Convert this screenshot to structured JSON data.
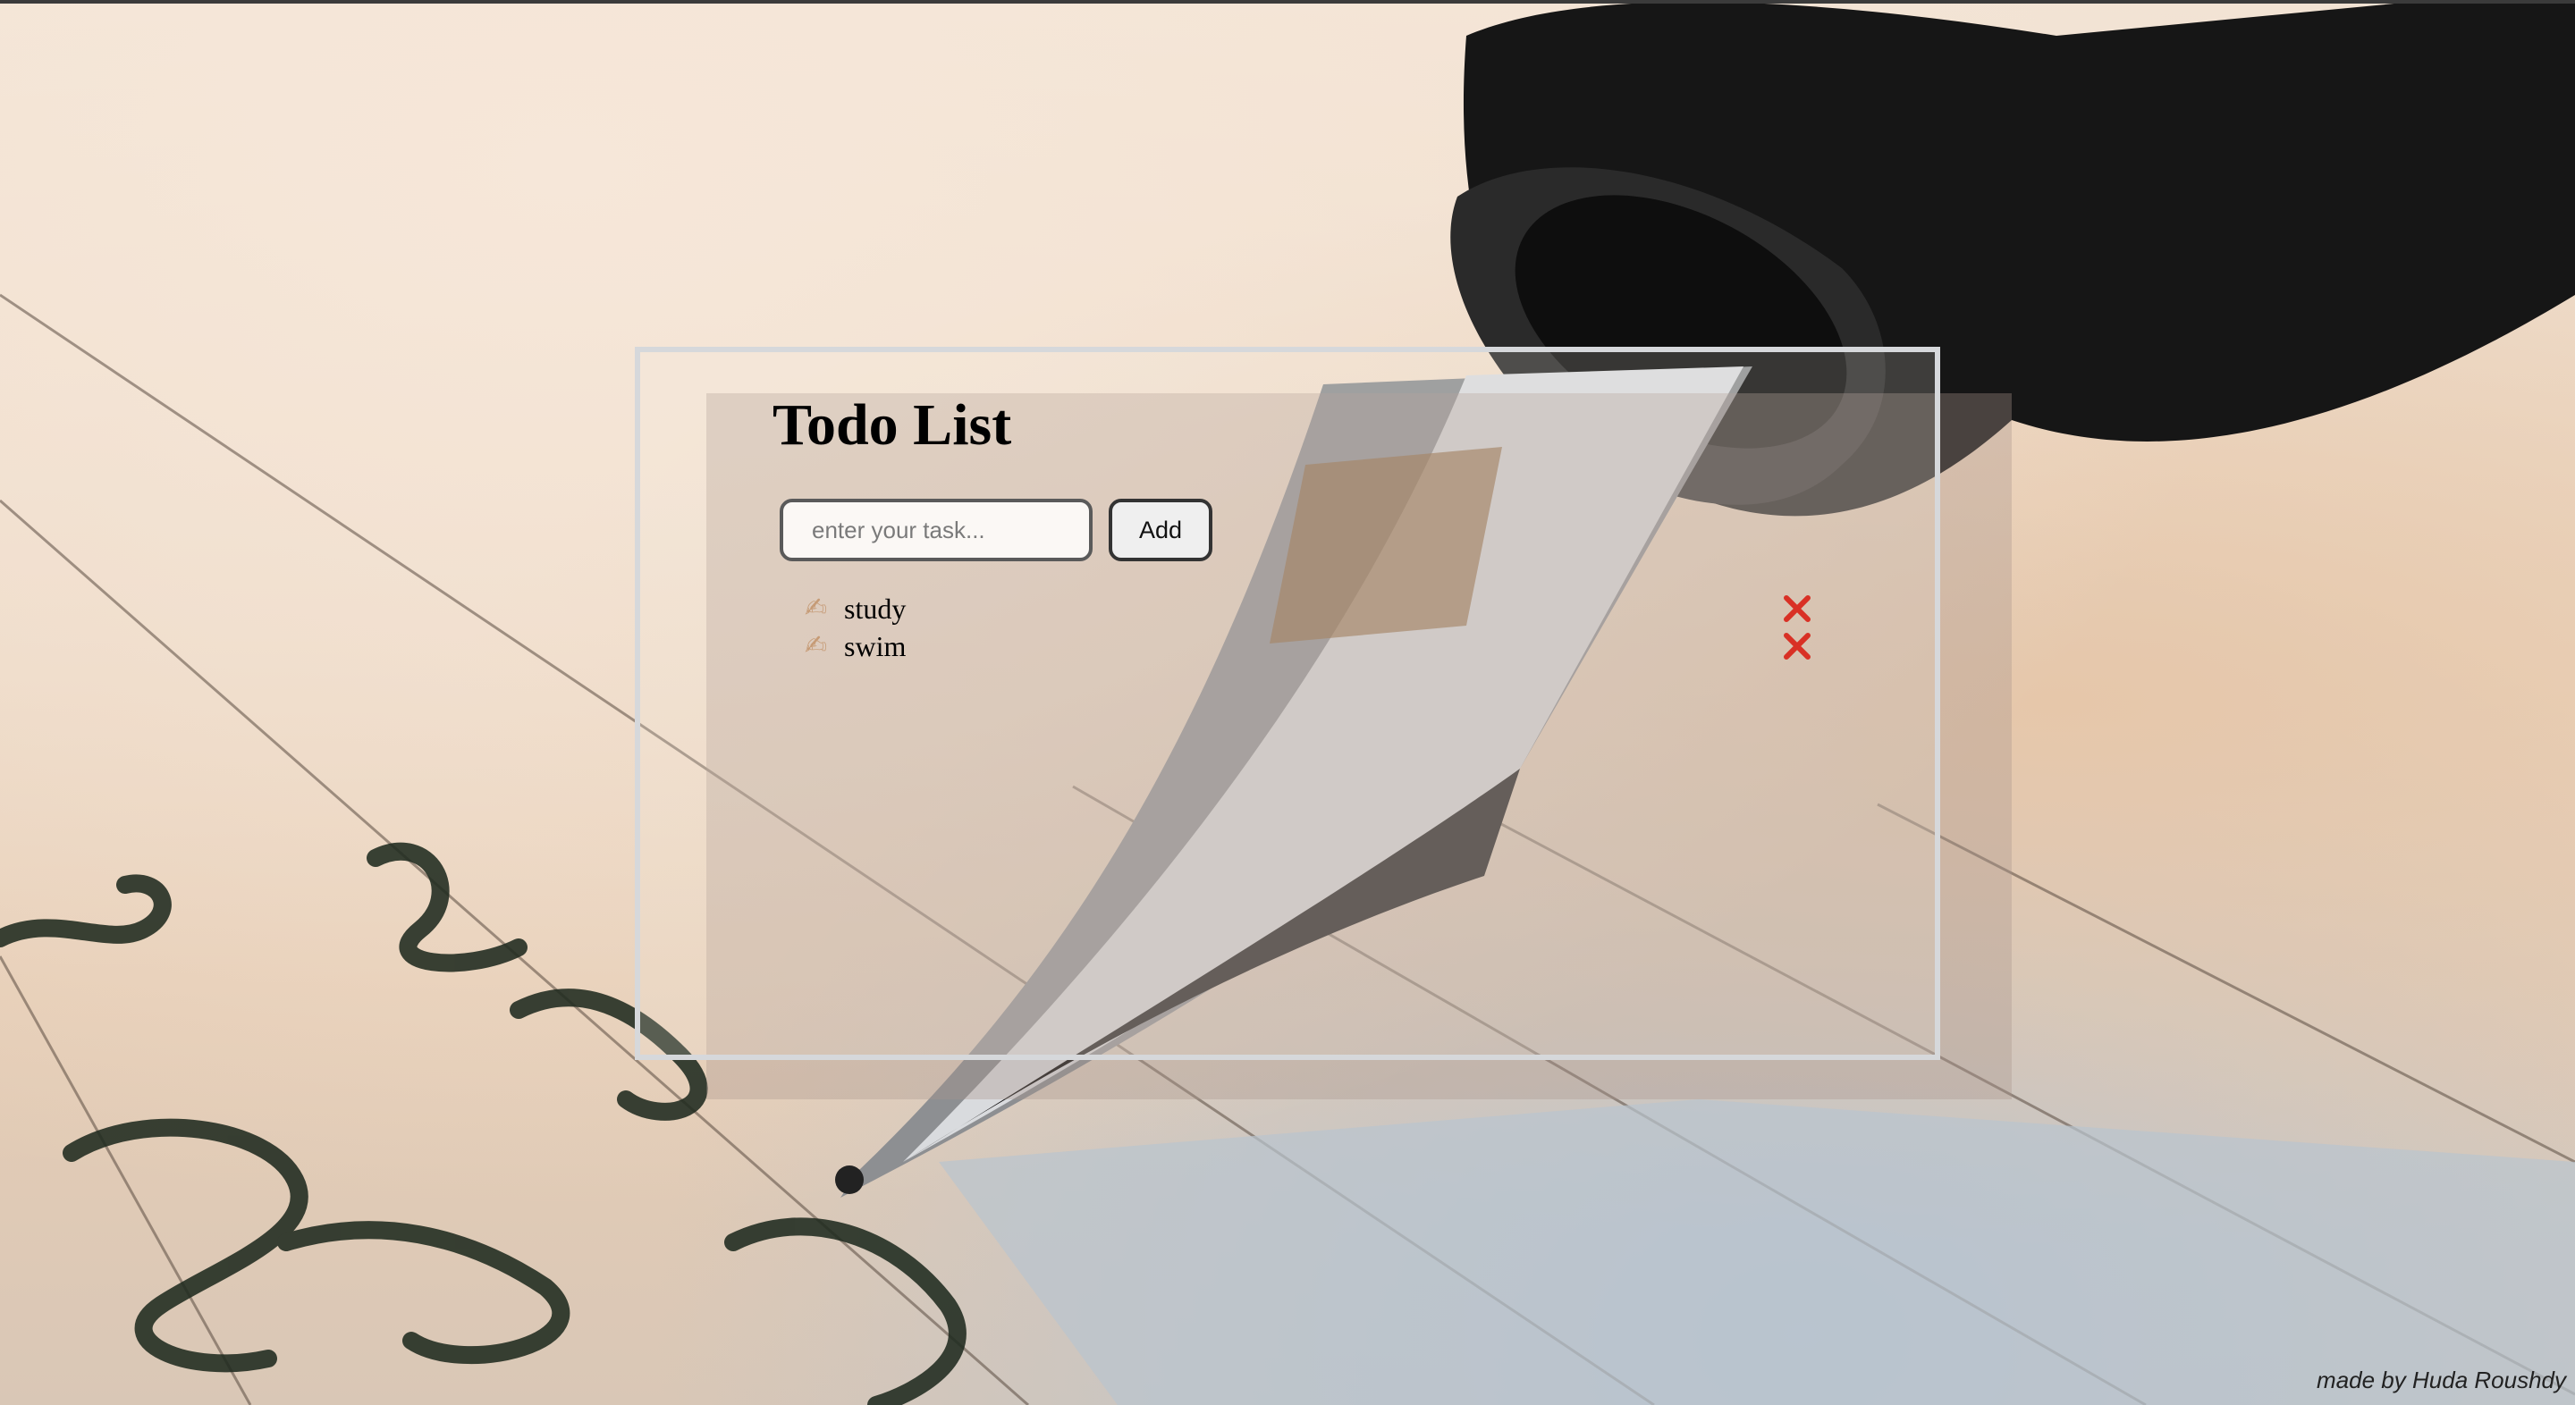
{
  "background": {
    "icon": "fountain-pen-writing-photo"
  },
  "app": {
    "title": "Todo List"
  },
  "form": {
    "input_value": "",
    "input_placeholder": "enter your task...",
    "add_label": "Add"
  },
  "todos": [
    {
      "icon": "writing-hand-icon",
      "glyph": "✍",
      "text": "study",
      "delete_icon": "close-icon"
    },
    {
      "icon": "writing-hand-icon",
      "glyph": "✍",
      "text": "swim",
      "delete_icon": "close-icon"
    }
  ],
  "footer": {
    "credit": "made by Huda Roushdy"
  },
  "colors": {
    "delete": "#d93025",
    "card_border": "#d6d8db"
  }
}
